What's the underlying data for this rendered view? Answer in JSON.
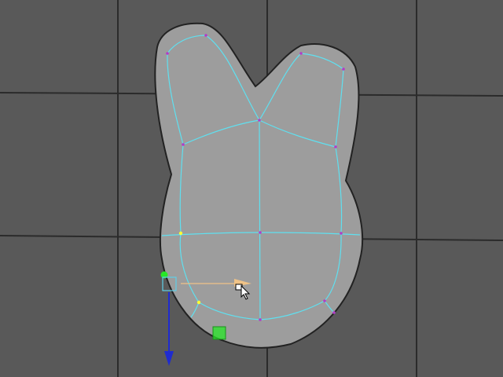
{
  "viewport": {
    "background": "#595959",
    "grid_color": "#2b2b2b"
  },
  "mesh": {
    "surface_color": "#9d9d9d",
    "outline_color": "#222222",
    "wire_color": "#5fe0f0",
    "vertex_color": "#b23cc8",
    "selected_vertex_color": "#ffff33",
    "selected_vertex_count": 2
  },
  "manipulator": {
    "type": "move",
    "y_axis_color": "#1f2bd0",
    "x_axis_color": "#f0c387",
    "z_axis_color": "#27e827",
    "center_color": "#5fcfe8",
    "icons": [
      "move-manipulator-icon",
      "mouse-pointer-icon"
    ]
  }
}
